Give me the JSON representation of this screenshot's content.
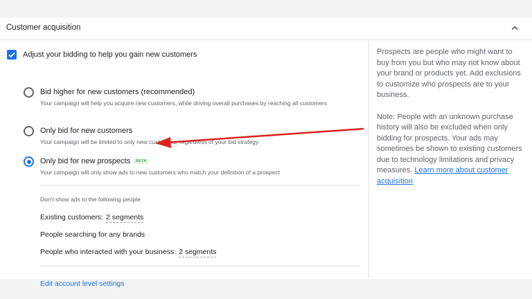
{
  "header": {
    "title": "Customer acquisition"
  },
  "main_checkbox": {
    "label": "Adjust your bidding to help you gain new customers",
    "checked": true
  },
  "options": [
    {
      "title": "Bid higher for new customers (recommended)",
      "desc": "Your campaign will help you acquire new customers, while driving overall purchases by reaching all customers",
      "selected": false
    },
    {
      "title": "Only bid for new customers",
      "desc": "Your campaign will be limited to only new customers, regardless of your bid strategy",
      "selected": false
    },
    {
      "title": "Only bid for new prospects",
      "badge": "BETA",
      "desc": "Your campaign will only show ads to new customers who match your definition of a prospect",
      "selected": true
    }
  ],
  "exclusions": {
    "heading": "Don't show ads to the following people",
    "existing_label": "Existing customers:",
    "existing_value": "2 segments",
    "searching_label": "People searching for any brands",
    "interacted_label": "People who interacted with your business:",
    "interacted_value": "2 segments"
  },
  "edit_link": "Edit account level settings",
  "sidebar": {
    "para1": "Prospects are people who might want to buy from you but who may not know about your brand or products yet. Add exclusions to customize who prospects are to your business.",
    "para2": "Note: People with an unknown purchase history will also be excluded when only bidding for prospects. Your ads may sometimes be shown to existing customers due to technology limitations and privacy measures.",
    "link": "Learn more about customer acquisition"
  },
  "colors": {
    "accent": "#1a73e8",
    "annotation_arrow": "#e02020",
    "beta_text": "#188038"
  },
  "icons": {
    "collapse": "chevron-up-icon",
    "check": "check-icon"
  }
}
